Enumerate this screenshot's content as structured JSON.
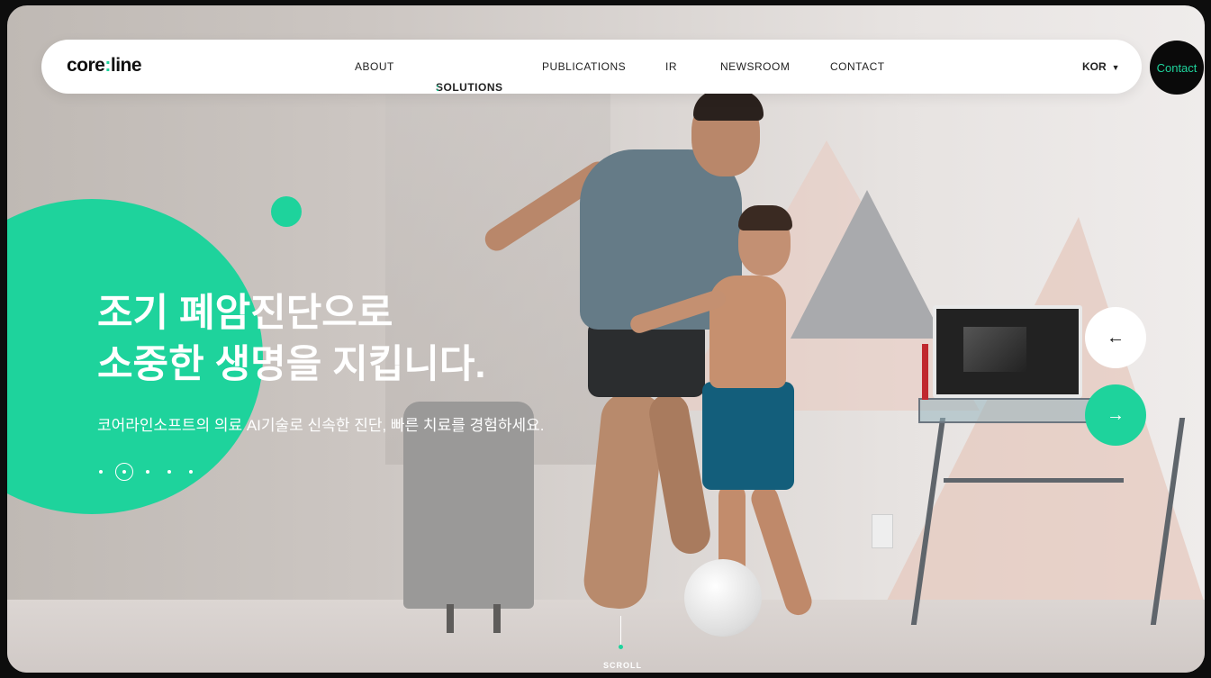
{
  "nav": {
    "logo": {
      "prefix": "core",
      "colon": ":",
      "suffix": "line"
    },
    "items": [
      {
        "label": "ABOUT"
      },
      {
        "label": "SOLUTIONS",
        "marker": ":"
      },
      {
        "label": "PUBLICATIONS"
      },
      {
        "label": "IR"
      },
      {
        "label": "NEWSROOM"
      },
      {
        "label": "CONTACT"
      }
    ],
    "language": "KOR",
    "contact_button": "Contact"
  },
  "hero": {
    "title_line1": "조기 폐암진단으로",
    "title_line2": "소중한 생명을 지킵니다.",
    "subtitle": "코어라인소프트의 의료 AI기술로 신속한 진단, 빠른 치료를 경험하세요.",
    "slides_total": 5,
    "current_slide": 2
  },
  "slider": {
    "prev_icon": "arrow-left-icon",
    "next_icon": "arrow-right-icon"
  },
  "scroll": {
    "label": "SCROLL"
  },
  "colors": {
    "accent": "#1ed39c",
    "nav_bg": "#ffffff",
    "contact_bg": "#0a0a0a"
  }
}
